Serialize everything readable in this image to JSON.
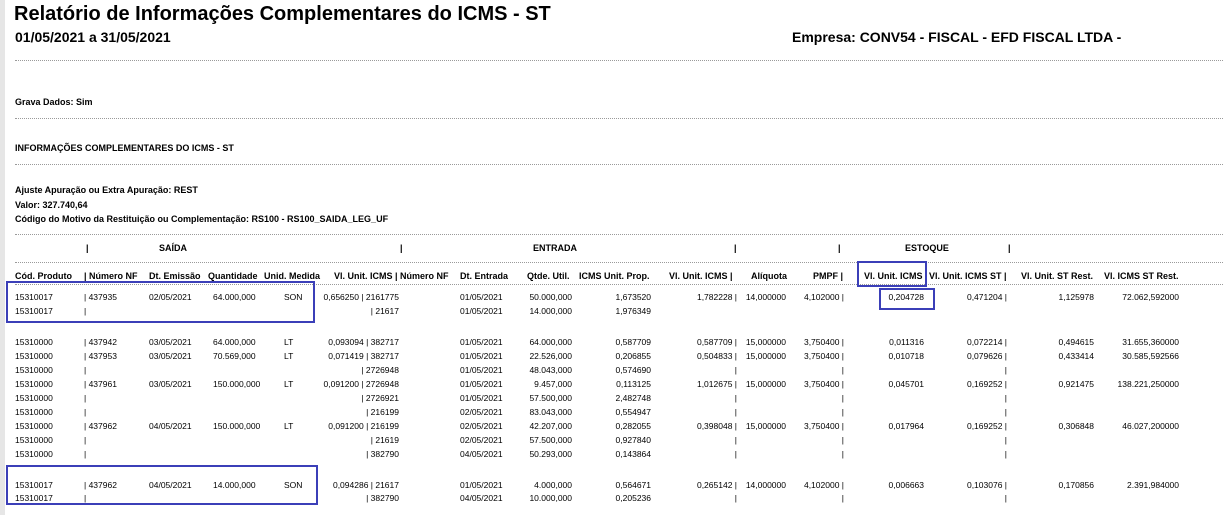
{
  "report": {
    "title": "Relatório de Informações Complementares do ICMS - ST",
    "period": "01/05/2021 a 31/05/2021",
    "company": "Empresa: CONV54 - FISCAL - EFD FISCAL LTDA -",
    "grava_dados": "Grava Dados: Sim",
    "section_title": "INFORMAÇÕES COMPLEMENTARES DO ICMS - ST",
    "ajuste": "Ajuste Apuração ou Extra Apuração: REST",
    "valor": "Valor: 327.740,64",
    "codigo_motivo": "Código do Motivo da Restituição ou Complementação: RS100 - RS100_SAIDA_LEG_UF"
  },
  "groups": {
    "saida": "SAÍDA",
    "entrada": "ENTRADA",
    "estoque": "ESTOQUE",
    "bar": "|"
  },
  "columns": [
    "Cód. Produto",
    "| Número NF",
    "Dt. Emissão",
    "Quantidade",
    "Unid. Medida",
    "Vl. Unit. ICMS | Número NF",
    "Dt. Entrada",
    "Qtde. Util.",
    "ICMS Unit. Prop.",
    "Vl. Unit. ICMS |",
    "Alíquota",
    "PMPF |",
    "Vl. Unit. ICMS",
    "Vl. Unit. ICMS ST |",
    "Vl. Unit. ST Rest.",
    "Vl. ICMS ST Rest."
  ],
  "rows": [
    [
      "15310017",
      "| 437935",
      "02/05/2021",
      "64.000,000",
      "SON",
      "0,656250 | 2161775",
      "01/05/2021",
      "50.000,000",
      "1,673520",
      "1,782228 |",
      "14,000000",
      "4,102000 |",
      "0,204728",
      "0,471204 |",
      "1,125978",
      "72.062,592000"
    ],
    [
      "15310017",
      "|",
      "",
      "",
      "",
      "| 21617",
      "01/05/2021",
      "14.000,000",
      "1,976349",
      "",
      "",
      "",
      "",
      "",
      "",
      ""
    ],
    [
      "15310000",
      "| 437942",
      "03/05/2021",
      "64.000,000",
      "LT",
      "0,093094 | 382717",
      "01/05/2021",
      "64.000,000",
      "0,587709",
      "0,587709 |",
      "15,000000",
      "3,750400 |",
      "0,011316",
      "0,072214 |",
      "0,494615",
      "31.655,360000"
    ],
    [
      "15310000",
      "| 437953",
      "03/05/2021",
      "70.569,000",
      "LT",
      "0,071419 | 382717",
      "01/05/2021",
      "22.526,000",
      "0,206855",
      "0,504833 |",
      "15,000000",
      "3,750400 |",
      "0,010718",
      "0,079626 |",
      "0,433414",
      "30.585,592566"
    ],
    [
      "15310000",
      "|",
      "",
      "",
      "",
      "| 2726948",
      "01/05/2021",
      "48.043,000",
      "0,574690",
      "|",
      "",
      "|",
      "",
      "|",
      "",
      ""
    ],
    [
      "15310000",
      "| 437961",
      "03/05/2021",
      "150.000,000",
      "LT",
      "0,091200 | 2726948",
      "01/05/2021",
      "9.457,000",
      "0,113125",
      "1,012675 |",
      "15,000000",
      "3,750400 |",
      "0,045701",
      "0,169252 |",
      "0,921475",
      "138.221,250000"
    ],
    [
      "15310000",
      "|",
      "",
      "",
      "",
      "| 2726921",
      "01/05/2021",
      "57.500,000",
      "2,482748",
      "|",
      "",
      "|",
      "",
      "|",
      "",
      ""
    ],
    [
      "15310000",
      "|",
      "",
      "",
      "",
      "| 216199",
      "02/05/2021",
      "83.043,000",
      "0,554947",
      "|",
      "",
      "|",
      "",
      "|",
      "",
      ""
    ],
    [
      "15310000",
      "| 437962",
      "04/05/2021",
      "150.000,000",
      "LT",
      "0,091200 | 216199",
      "02/05/2021",
      "42.207,000",
      "0,282055",
      "0,398048 |",
      "15,000000",
      "3,750400 |",
      "0,017964",
      "0,169252 |",
      "0,306848",
      "46.027,200000"
    ],
    [
      "15310000",
      "|",
      "",
      "",
      "",
      "| 21619",
      "02/05/2021",
      "57.500,000",
      "0,927840",
      "|",
      "",
      "|",
      "",
      "|",
      "",
      ""
    ],
    [
      "15310000",
      "|",
      "",
      "",
      "",
      "| 382790",
      "04/05/2021",
      "50.293,000",
      "0,143864",
      "|",
      "",
      "|",
      "",
      "|",
      "",
      ""
    ],
    [
      "15310017",
      "| 437962",
      "04/05/2021",
      "14.000,000",
      "SON",
      "0,094286 | 21617",
      "01/05/2021",
      "4.000,000",
      "0,564671",
      "0,265142 |",
      "14,000000",
      "4,102000 |",
      "0,006663",
      "0,103076 |",
      "0,170856",
      "2.391,984000"
    ],
    [
      "15310017",
      "|",
      "",
      "",
      "",
      "| 382790",
      "04/05/2021",
      "10.000,000",
      "0,205236",
      "|",
      "",
      "|",
      "",
      "|",
      "",
      ""
    ]
  ]
}
